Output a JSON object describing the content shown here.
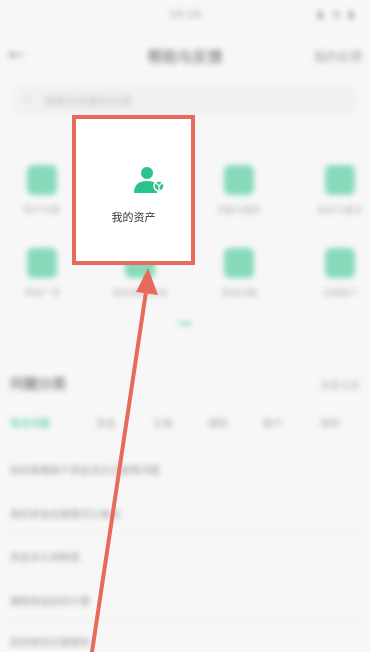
{
  "status": {
    "time": "10:10",
    "icons": "▮ ◔ ▮"
  },
  "nav": {
    "title": "帮助与反馈",
    "right": "我的反馈"
  },
  "search": {
    "placeholder": "搜索你想要的问题"
  },
  "grid": [
    {
      "label": "账户问题"
    },
    {
      "label": "我的资产"
    },
    {
      "label": "功能与服务"
    },
    {
      "label": "投诉与建议"
    },
    {
      "label": "风险广场"
    },
    {
      "label": "联系客服热线"
    },
    {
      "label": "其他问题"
    },
    {
      "label": "注销账户"
    }
  ],
  "highlight": {
    "label": "我的资产"
  },
  "section": {
    "title": "问题分类",
    "more": "查看全部"
  },
  "tabs": [
    "常见问题",
    "资金",
    "交易",
    "理财",
    "账户",
    "保险"
  ],
  "questions": [
    "如何查看账户资金流水记录等问题",
    "我的资金在哪里可以查询",
    "资金多久到账呢",
    "理财收益如何计算",
    "如何修改交易密码"
  ],
  "colors": {
    "accent": "#2bc38a",
    "highlight_border": "#e86a5a"
  }
}
